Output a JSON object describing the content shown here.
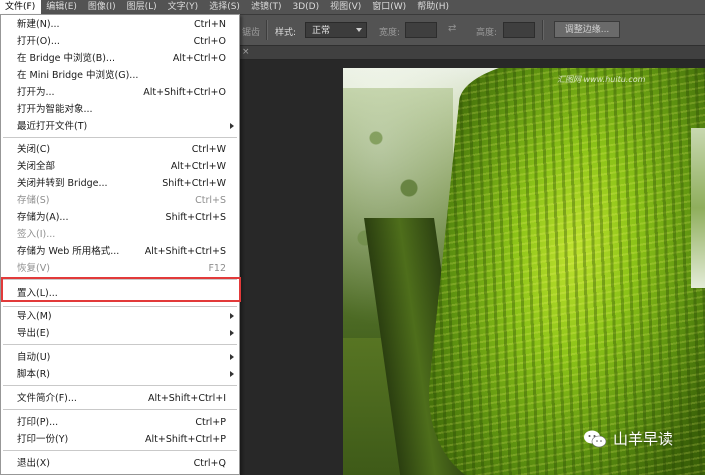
{
  "menubar": {
    "items": [
      {
        "label": "文件(F)",
        "active": true
      },
      {
        "label": "编辑(E)"
      },
      {
        "label": "图像(I)"
      },
      {
        "label": "图层(L)"
      },
      {
        "label": "文字(Y)"
      },
      {
        "label": "选择(S)"
      },
      {
        "label": "滤镜(T)"
      },
      {
        "label": "3D(D)"
      },
      {
        "label": "视图(V)"
      },
      {
        "label": "窗口(W)"
      },
      {
        "label": "帮助(H)"
      }
    ]
  },
  "options": {
    "partial_label": "锯齿",
    "style_label": "样式:",
    "style_value": "正常",
    "width_label": "宽度:",
    "height_label": "高度:",
    "refine_edge": "调整边缘..."
  },
  "file_menu": {
    "items": [
      {
        "label": "新建(N)...",
        "shortcut": "Ctrl+N"
      },
      {
        "label": "打开(O)...",
        "shortcut": "Ctrl+O"
      },
      {
        "label": "在 Bridge 中浏览(B)...",
        "shortcut": "Alt+Ctrl+O"
      },
      {
        "label": "在 Mini Bridge 中浏览(G)...",
        "shortcut": ""
      },
      {
        "label": "打开为...",
        "shortcut": "Alt+Shift+Ctrl+O"
      },
      {
        "label": "打开为智能对象...",
        "shortcut": ""
      },
      {
        "label": "最近打开文件(T)",
        "shortcut": "",
        "submenu": true
      },
      {
        "label": "关闭(C)",
        "shortcut": "Ctrl+W"
      },
      {
        "label": "关闭全部",
        "shortcut": "Alt+Ctrl+W"
      },
      {
        "label": "关闭并转到 Bridge...",
        "shortcut": "Shift+Ctrl+W"
      },
      {
        "label": "存储(S)",
        "shortcut": "Ctrl+S",
        "disabled": true
      },
      {
        "label": "存储为(A)...",
        "shortcut": "Shift+Ctrl+S"
      },
      {
        "label": "签入(I)...",
        "shortcut": "",
        "disabled": true
      },
      {
        "label": "存储为 Web 所用格式...",
        "shortcut": "Alt+Shift+Ctrl+S"
      },
      {
        "label": "恢复(V)",
        "shortcut": "F12",
        "disabled": true
      },
      {
        "label": "置入(L)...",
        "shortcut": ""
      },
      {
        "label": "导入(M)",
        "shortcut": "",
        "submenu": true
      },
      {
        "label": "导出(E)",
        "shortcut": "",
        "submenu": true
      },
      {
        "label": "自动(U)",
        "shortcut": "",
        "submenu": true
      },
      {
        "label": "脚本(R)",
        "shortcut": "",
        "submenu": true
      },
      {
        "label": "文件简介(F)...",
        "shortcut": "Alt+Shift+Ctrl+I"
      },
      {
        "label": "打印(P)...",
        "shortcut": "Ctrl+P"
      },
      {
        "label": "打印一份(Y)",
        "shortcut": "Alt+Shift+Ctrl+P"
      },
      {
        "label": "退出(X)",
        "shortcut": "Ctrl+Q"
      }
    ]
  },
  "canvas": {
    "watermark": "汇图网 www.huitu.com",
    "brand": "山羊早读"
  },
  "colors": {
    "highlight": "#e23a3a",
    "menubar": "#535353"
  }
}
